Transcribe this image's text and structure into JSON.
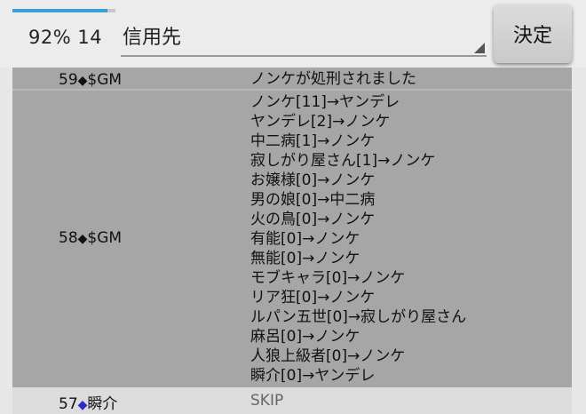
{
  "header": {
    "progress_fraction": 0.92,
    "status_text": "92% 14",
    "target_label": "信用先",
    "decide_label": "決定"
  },
  "log": {
    "entries": [
      {
        "number": "59",
        "marker": "◆",
        "speaker": "$GM",
        "lines": [
          "ノンケが処刑されました"
        ]
      },
      {
        "number": "58",
        "marker": "◆",
        "speaker": "$GM",
        "lines": [
          "ノンケ[11]→ヤンデレ",
          "ヤンデレ[2]→ノンケ",
          "中二病[1]→ノンケ",
          "寂しがり屋さん[1]→ノンケ",
          "お嬢様[0]→ノンケ",
          "男の娘[0]→中二病",
          "火の鳥[0]→ノンケ",
          "有能[0]→ノンケ",
          "無能[0]→ノンケ",
          "モブキャラ[0]→ノンケ",
          "リア狂[0]→ノンケ",
          "ルパン五世[0]→寂しがり屋さん",
          "麻呂[0]→ノンケ",
          "人狼上級者[0]→ノンケ",
          "瞬介[0]→ヤンデレ"
        ]
      },
      {
        "number": "57",
        "marker": "◆",
        "speaker": "瞬介",
        "lines": [
          "SKIP"
        ]
      }
    ]
  }
}
